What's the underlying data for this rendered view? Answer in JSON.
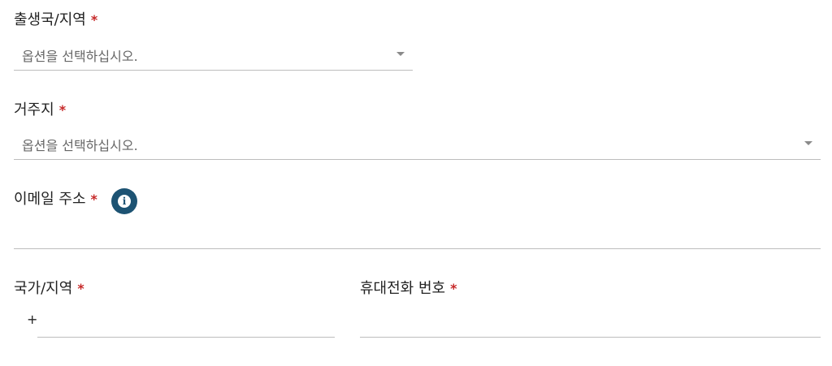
{
  "fields": {
    "birth_country": {
      "label": "출생국/지역",
      "required_mark": "*",
      "placeholder": "옵션을 선택하십시오."
    },
    "residence": {
      "label": "거주지",
      "required_mark": "*",
      "placeholder": "옵션을 선택하십시오."
    },
    "email": {
      "label": "이메일 주소",
      "required_mark": "*",
      "value": "",
      "info_icon": "info-icon"
    },
    "country_code": {
      "label": "국가/지역",
      "required_mark": "*",
      "prefix": "+",
      "value": ""
    },
    "phone": {
      "label": "휴대전화 번호",
      "required_mark": "*",
      "value": ""
    }
  },
  "colors": {
    "required": "#c62828",
    "info_icon_bg": "#1d5373",
    "underline": "#bdbdbd"
  }
}
